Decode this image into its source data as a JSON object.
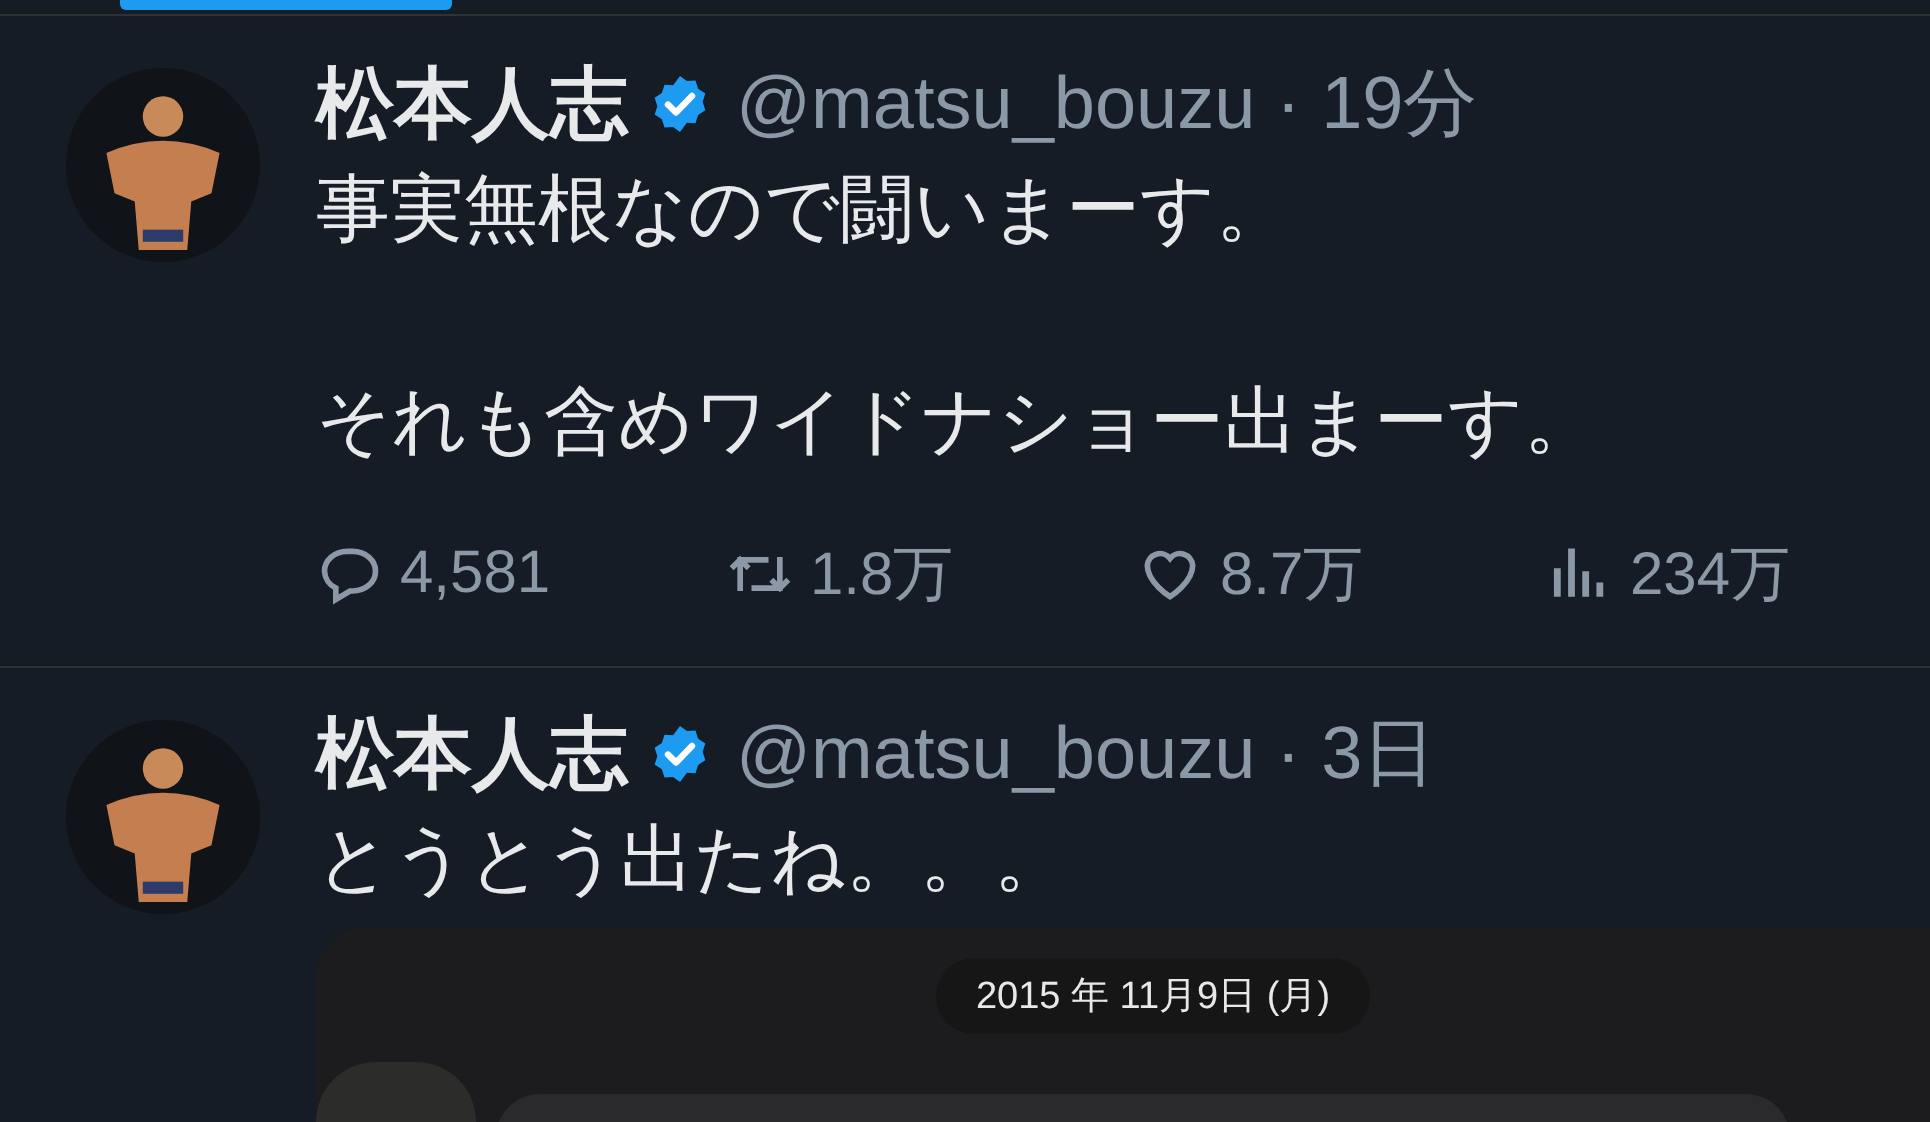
{
  "tabs": [
    {
      "selected": true
    }
  ],
  "tweets": [
    {
      "author": "松本人志",
      "verified": true,
      "meta": "@matsu_bouzu · 19分",
      "paragraphs": [
        "事実無根なので闘いまーす。",
        "それも含めワイドナショー出まーす。"
      ],
      "actions": [
        {
          "kind": "reply",
          "count": "4,581"
        },
        {
          "kind": "retweet",
          "count": "1.8万"
        },
        {
          "kind": "like",
          "count": "8.7万"
        },
        {
          "kind": "views",
          "count": "234万"
        }
      ]
    },
    {
      "author": "松本人志",
      "verified": true,
      "meta": "@matsu_bouzu · 3日",
      "paragraphs": [
        "とうとう出たね。。。"
      ],
      "media": {
        "kind": "chat_screenshot",
        "date": "2015 年 11月9日 (月)"
      }
    }
  ]
}
